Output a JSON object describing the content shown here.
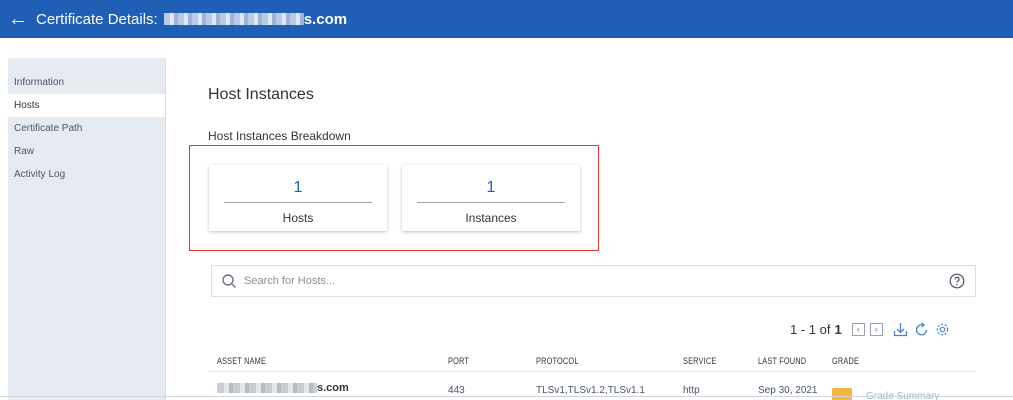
{
  "header": {
    "back_symbol": "←",
    "title_label": "Certificate Details:",
    "title_suffix": "s.com"
  },
  "sidebar": {
    "items": [
      {
        "label": "Information"
      },
      {
        "label": "Hosts",
        "active": true
      },
      {
        "label": "Certificate Path"
      },
      {
        "label": "Raw"
      },
      {
        "label": "Activity Log"
      }
    ]
  },
  "main": {
    "title": "Host Instances",
    "subtitle": "Host Instances Breakdown",
    "stats": [
      {
        "value": "1",
        "label": "Hosts"
      },
      {
        "value": "1",
        "label": "Instances"
      }
    ],
    "search": {
      "placeholder": "Search for Hosts..."
    },
    "pagination": {
      "range": "1 - 1 of",
      "total": "1"
    }
  },
  "table": {
    "headers": [
      "ASSET NAME",
      "PORT",
      "PROTOCOL",
      "SERVICE",
      "LAST FOUND",
      "GRADE"
    ],
    "rows": [
      {
        "asset_suffix": "s.com",
        "port": "443",
        "protocol": "TLSv1,TLSv1.2,TLSv1.1",
        "service": "http",
        "last_found": "Sep 30, 2021",
        "grade_link": "Grade Summary"
      }
    ]
  },
  "colors": {
    "accent": "#1f5fb5",
    "highlight_border": "#e53935",
    "grade_badge": "#f4b73c"
  },
  "icons": [
    "search-icon",
    "help-icon",
    "chevron-left-icon",
    "chevron-right-icon",
    "download-icon",
    "refresh-icon",
    "gear-icon"
  ]
}
